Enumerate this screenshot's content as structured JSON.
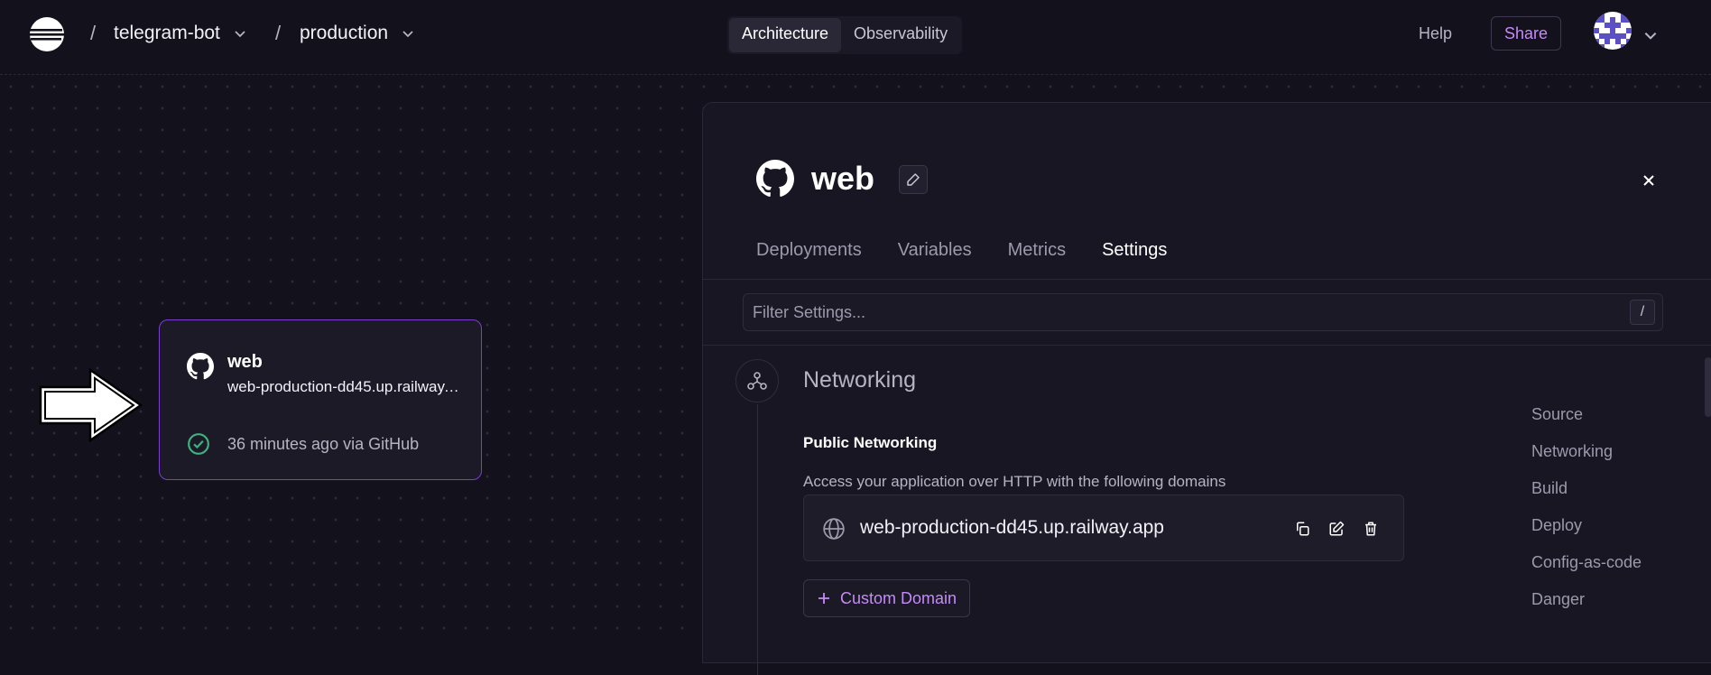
{
  "header": {
    "separator": "/",
    "project": "telegram-bot",
    "environment": "production",
    "view_tabs": [
      {
        "label": "Architecture",
        "active": true
      },
      {
        "label": "Observability",
        "active": false
      }
    ],
    "help": "Help",
    "share": "Share"
  },
  "canvas": {
    "service_card": {
      "name": "web",
      "url": "web-production-dd45.up.railway.app",
      "status": "36 minutes ago via GitHub"
    }
  },
  "panel": {
    "title": "web",
    "tabs": [
      {
        "label": "Deployments",
        "active": false
      },
      {
        "label": "Variables",
        "active": false
      },
      {
        "label": "Metrics",
        "active": false
      },
      {
        "label": "Settings",
        "active": true
      }
    ],
    "filter": {
      "placeholder": "Filter Settings...",
      "value": "",
      "shortcut": "/"
    },
    "section": {
      "title": "Networking",
      "subtitle": "Public Networking",
      "description": "Access your application over HTTP with the following domains",
      "domain": "web-production-dd45.up.railway.app",
      "custom_domain_label": "Custom Domain"
    },
    "jump_nav": [
      "Source",
      "Networking",
      "Build",
      "Deploy",
      "Config-as-code",
      "Danger"
    ]
  },
  "colors": {
    "background": "#13111c",
    "panel": "#181622",
    "accent": "#c58af9",
    "card_border": "#7a3fd0",
    "success": "#3fb27f"
  },
  "icons": [
    "railway-logo-icon",
    "chevron-down-icon",
    "github-icon",
    "check-circle-icon",
    "pencil-icon",
    "close-icon",
    "network-icon",
    "globe-icon",
    "copy-icon",
    "edit-icon",
    "trash-icon",
    "plus-icon",
    "arrow-annotation-icon"
  ]
}
